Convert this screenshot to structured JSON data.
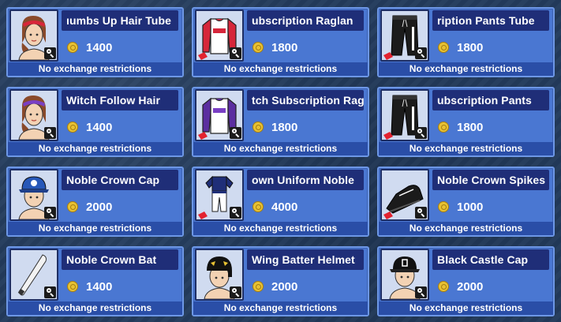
{
  "currency_icon": "gold-coin-icon",
  "items": [
    {
      "name": "Thumbs Up Hair Tube",
      "display_name": "ıumbs Up Hair    Tube",
      "price": "1400",
      "restriction": "No exchange restrictions",
      "icon": "female-avatar-red-headband-icon"
    },
    {
      "name": "Subscription Raglan",
      "display_name": "ubscription Raglan",
      "price": "1800",
      "restriction": "No exchange restrictions",
      "icon": "red-white-raglan-shirt-icon"
    },
    {
      "name": "Subscription Pants",
      "display_name": "ription Pants         Tube",
      "price": "1800",
      "restriction": "No exchange restrictions",
      "icon": "black-pants-icon"
    },
    {
      "name": "Witch Follow Hair",
      "display_name": "Witch Follow Hair",
      "price": "1400",
      "restriction": "No exchange restrictions",
      "icon": "female-avatar-purple-headband-icon"
    },
    {
      "name": "Witch Subscription Raglan",
      "display_name": "tch Subscription Ragl",
      "price": "1800",
      "restriction": "No exchange restrictions",
      "icon": "purple-white-raglan-shirt-icon"
    },
    {
      "name": "Subscription Pants",
      "display_name": "ubscription Pants",
      "price": "1800",
      "restriction": "No exchange restrictions",
      "icon": "black-pants-icon"
    },
    {
      "name": "Noble Crown Cap",
      "display_name": "Noble Crown Cap",
      "price": "2000",
      "restriction": "No exchange restrictions",
      "icon": "avatar-blue-cap-icon"
    },
    {
      "name": "Noble Crown Uniform",
      "display_name": "own Uniform     Noble",
      "price": "4000",
      "restriction": "No exchange restrictions",
      "icon": "baseball-uniform-icon"
    },
    {
      "name": "Noble Crown Spikes",
      "display_name": "Noble Crown Spikes",
      "price": "1000",
      "restriction": "No exchange restrictions",
      "icon": "black-cleat-shoe-icon"
    },
    {
      "name": "Noble Crown Bat",
      "display_name": "Noble Crown Bat",
      "price": "1400",
      "restriction": "No exchange restrictions",
      "icon": "baseball-bat-icon"
    },
    {
      "name": "Wing Batter Helmet",
      "display_name": "Wing Batter Helmet",
      "price": "2000",
      "restriction": "No exchange restrictions",
      "icon": "avatar-black-helmet-icon"
    },
    {
      "name": "Black Castle Cap",
      "display_name": "Black Castle Cap",
      "price": "2000",
      "restriction": "No exchange restrictions",
      "icon": "avatar-black-cap-icon"
    }
  ]
}
